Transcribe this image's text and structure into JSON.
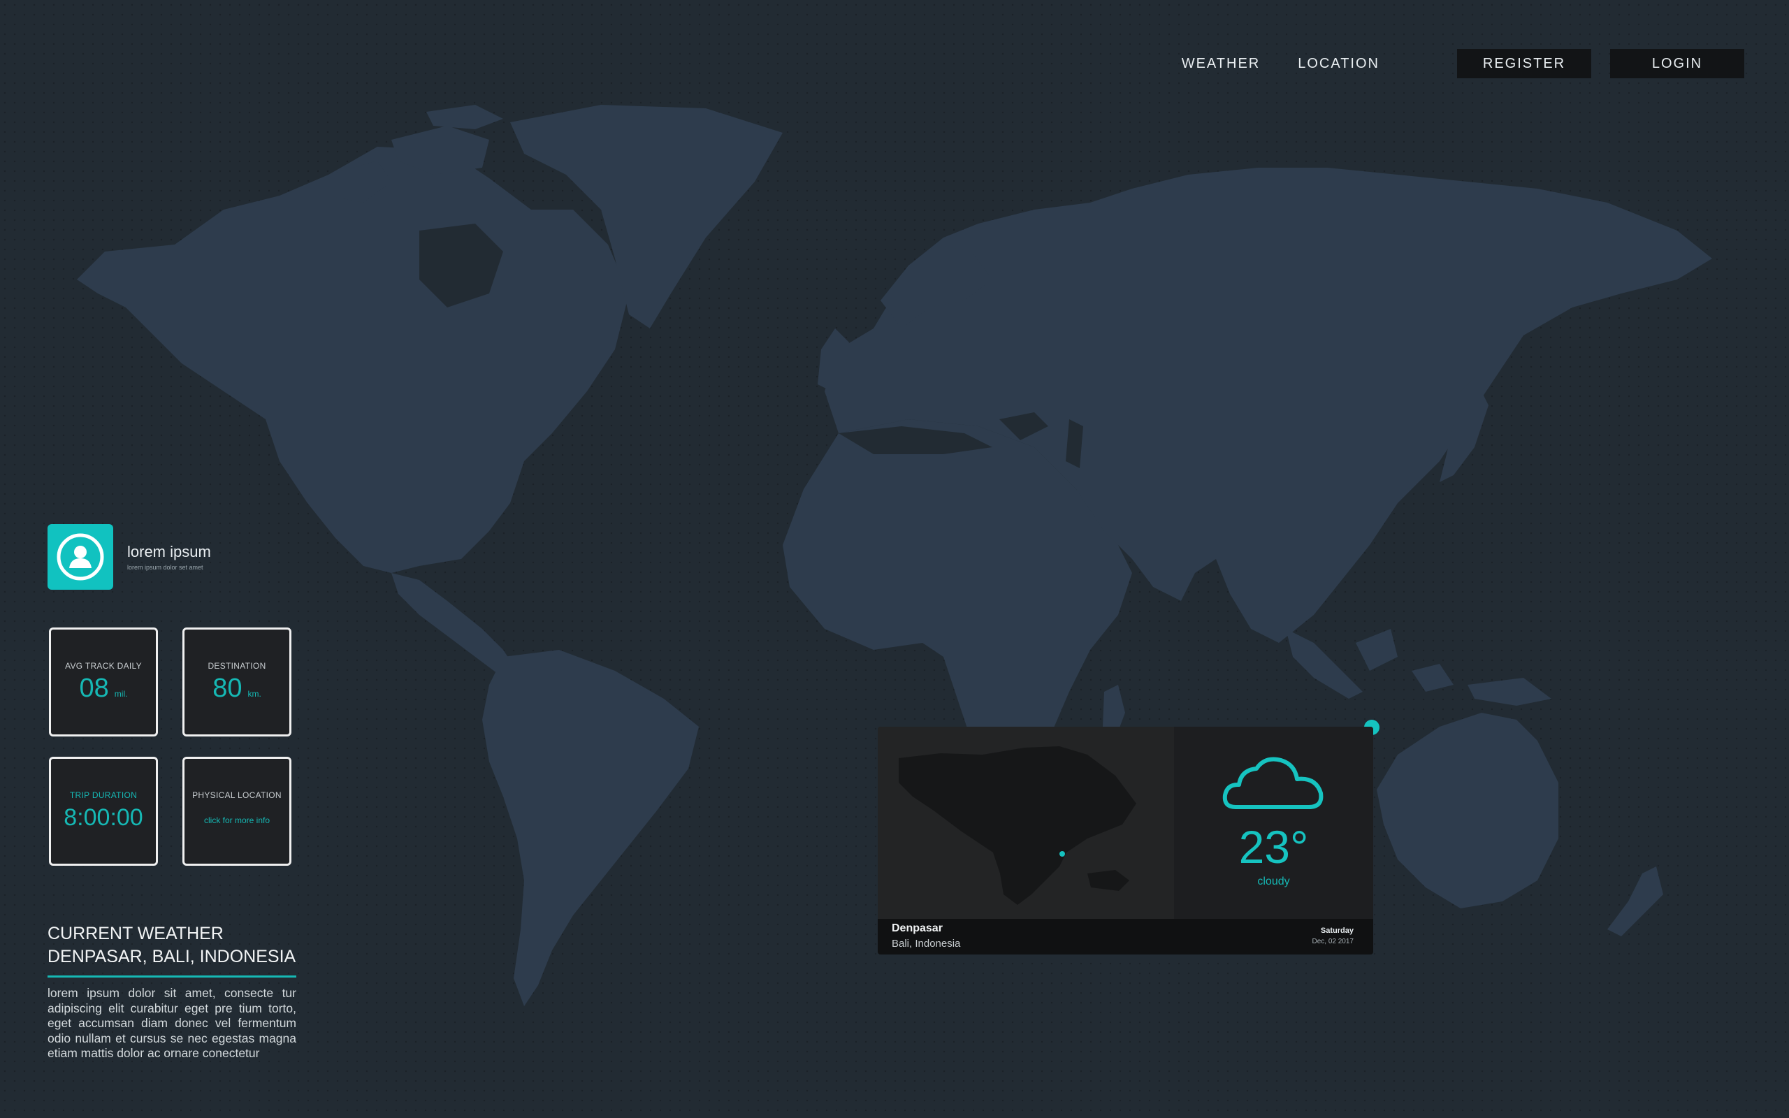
{
  "nav": {
    "links": [
      "WEATHER",
      "LOCATION"
    ],
    "buttons": [
      "REGISTER",
      "LOGIN"
    ]
  },
  "profile": {
    "name": "lorem ipsum",
    "subtitle": "lorem ipsum dolor set amet",
    "icon": "user-icon"
  },
  "stats": {
    "avg_track": {
      "label": "AVG TRACK DAILY",
      "value": "08",
      "unit": "mil."
    },
    "destination": {
      "label": "DESTINATION",
      "value": "80",
      "unit": "km."
    },
    "trip_duration": {
      "label": "TRIP DURATION",
      "value": "8:00:00"
    },
    "physical_location": {
      "label": "PHYSICAL LOCATION",
      "link": "click for more info"
    }
  },
  "current_weather": {
    "title_line1": "CURRENT WEATHER",
    "title_line2": "DENPASAR, BALI, INDONESIA",
    "body": "lorem ipsum dolor sit amet, consecte tur adipiscing elit curabitur eget pre  tium torto, eget accumsan diam donec vel fermentum odio nullam et cursus se nec egestas magna etiam mattis dolor ac ornare conectetur"
  },
  "widget": {
    "temperature": "23°",
    "condition": "cloudy",
    "city": "Denpasar",
    "region": "Bali, Indonesia",
    "day": "Saturday",
    "date": "Dec, 02 2017",
    "icon": "cloud-icon"
  },
  "colors": {
    "background": "#222b33",
    "land": "#2e3c4d",
    "accent": "#16b8b4"
  }
}
